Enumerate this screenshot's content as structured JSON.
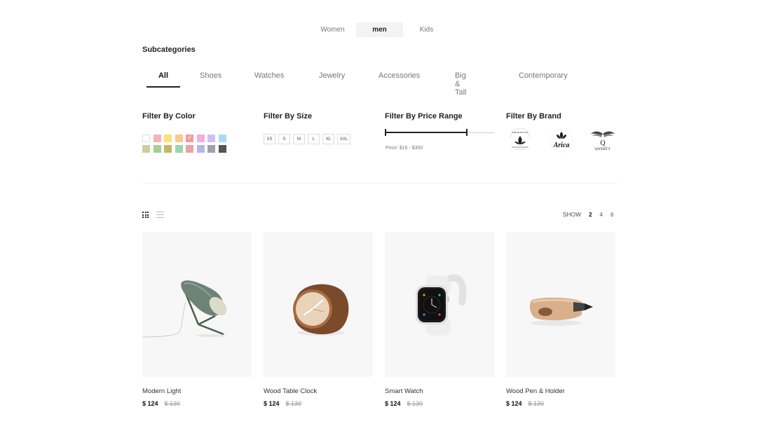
{
  "gender_tabs": [
    {
      "label": "Women"
    },
    {
      "label": "men"
    },
    {
      "label": "Kids"
    }
  ],
  "subcategories": {
    "title": "Subcategories",
    "items": [
      {
        "label": "All"
      },
      {
        "label": "Shoes"
      },
      {
        "label": "Watches"
      },
      {
        "label": "Jewelry"
      },
      {
        "label": "Accessories"
      },
      {
        "label": "Big & Tall"
      },
      {
        "label": "Contemporary"
      }
    ]
  },
  "filters": {
    "color": {
      "title": "Filter By Color",
      "swatches": [
        "#ffffff",
        "#f5b5b5",
        "#f7e17a",
        "#f9c98c",
        "#f39b9b",
        "#f3aee0",
        "#c9c3f5",
        "#a9dcf3",
        "#c9cfa7",
        "#a8cf95",
        "#c3b766",
        "#99d6b0",
        "#e9a4a4",
        "#b9b6e6",
        "#a0a0aa",
        "#555555"
      ],
      "selected_index": 4
    },
    "size": {
      "title": "Filter By Size",
      "options": [
        "XS",
        "S",
        "M",
        "L",
        "XL",
        "XXL"
      ]
    },
    "price": {
      "title": "Filter By Price Range",
      "text": "Price: $16 - $300",
      "range_fraction": [
        0,
        0.75
      ]
    },
    "brand": {
      "title": "Filter By Brand",
      "brands": [
        {
          "icon": "sarah-nicole-logo",
          "text": "SARAH NICOLE"
        },
        {
          "icon": "arica-logo",
          "text": "Arica"
        },
        {
          "icon": "qwerty-logo",
          "text": "QWERTY"
        }
      ]
    }
  },
  "toolbar": {
    "grid_icon": "grid-view-icon",
    "list_icon": "list-view-icon",
    "show_label": "SHOW",
    "show_options": [
      "2",
      "4",
      "6"
    ],
    "show_selected": "2"
  },
  "products": [
    {
      "name": "Modern Light",
      "price": "$ 124",
      "old_price": "$ 130",
      "image": "lamp"
    },
    {
      "name": "Wood Table Clock",
      "price": "$ 124",
      "old_price": "$ 130",
      "image": "clock"
    },
    {
      "name": "Smart Watch",
      "price": "$ 124",
      "old_price": "$ 130",
      "image": "watch"
    },
    {
      "name": "Wood Pen & Holder",
      "price": "$ 124",
      "old_price": "$ 130",
      "image": "pen"
    }
  ]
}
